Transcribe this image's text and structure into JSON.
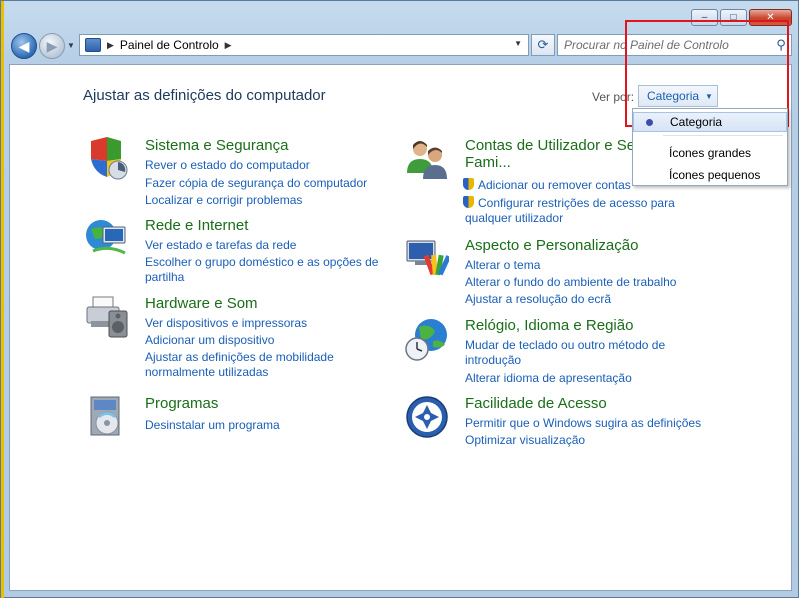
{
  "window": {
    "minimize": "–",
    "maximize": "□",
    "close": "✕"
  },
  "toolbar": {
    "back": "◀",
    "forward": "▶",
    "address": "Painel de Controlo",
    "search_placeholder": "Procurar no Painel de Controlo"
  },
  "main": {
    "title": "Ajustar as definições do computador",
    "view_by_label": "Ver por:",
    "view_by_value": "Categoria"
  },
  "view_menu": {
    "items": [
      "Categoria",
      "Ícones grandes",
      "Ícones pequenos"
    ],
    "selected": "Categoria"
  },
  "categories": {
    "system": {
      "title": "Sistema e Segurança",
      "icon": "shield-computer-icon",
      "links": [
        "Rever o estado do computador",
        "Fazer cópia de segurança do computador",
        "Localizar e corrigir problemas"
      ]
    },
    "network": {
      "title": "Rede e Internet",
      "icon": "globe-network-icon",
      "links": [
        "Ver estado e tarefas da rede",
        "Escolher o grupo doméstico e as opções de",
        "partilha"
      ]
    },
    "hardware": {
      "title": "Hardware e Som",
      "icon": "printer-speaker-icon",
      "links": [
        "Ver dispositivos e impressoras",
        "Adicionar um dispositivo",
        "Ajustar as definições de mobilidade",
        "normalmente utilizadas"
      ]
    },
    "programs": {
      "title": "Programas",
      "icon": "programs-disc-icon",
      "links": [
        "Desinstalar um programa"
      ]
    },
    "accounts": {
      "title_line1": "Contas de Utilizador e Se",
      "title_line2": "Fami...",
      "icon": "users-icon",
      "links": [
        "Adicionar ou remover contas",
        "Configurar restrições de acesso para",
        "qualquer utilizador"
      ]
    },
    "appearance": {
      "title": "Aspecto e Personalização",
      "icon": "monitor-palette-icon",
      "links": [
        "Alterar o tema",
        "Alterar o fundo do ambiente de trabalho",
        "Ajustar a resolução do ecrã"
      ]
    },
    "clock": {
      "title": "Relógio, Idioma e Região",
      "icon": "globe-clock-icon",
      "links": [
        "Mudar de teclado ou outro método de",
        "introdução",
        "Alterar idioma de apresentação"
      ]
    },
    "ease": {
      "title": "Facilidade de Acesso",
      "icon": "ease-of-access-icon",
      "links": [
        "Permitir que o Windows sugira as definições",
        "Optimizar visualização"
      ]
    }
  }
}
